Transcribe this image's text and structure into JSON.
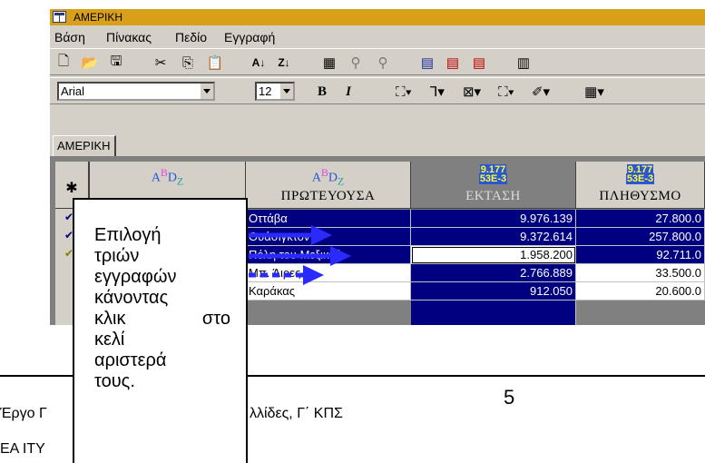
{
  "window": {
    "title": "ΑΜΕΡΙΚΗ"
  },
  "menu": {
    "items": [
      "Βάση",
      "Πίνακας",
      "Πεδίο",
      "Εγγραφή"
    ]
  },
  "toolbar1": {
    "icons": [
      "new-icon",
      "open-icon",
      "save-icon",
      "cut-icon",
      "copy-icon",
      "paste-icon",
      "sort-ascending-icon",
      "sort-descending-icon",
      "filter-icon",
      "find-icon",
      "find-next-icon",
      "add-record-icon",
      "delete-record-icon",
      "delete-icon",
      "table-view-icon"
    ]
  },
  "toolbar2": {
    "font_name": "Arial",
    "font_size": "12",
    "bold_label": "B",
    "italic_label": "I"
  },
  "tab": {
    "label": "ΑΜΕΡΙΚΗ"
  },
  "grid": {
    "corner_symbol": "✱",
    "headers": [
      {
        "type_glyph": "ABDZ",
        "label": ""
      },
      {
        "type_glyph": "ABDZ",
        "label": "ΠΡΩΤΕΥΟΥΣΑ"
      },
      {
        "type_glyph_top": "9.177",
        "type_glyph_bottom": "53E-3",
        "label": "ΕΚΤΑΣΗ"
      },
      {
        "type_glyph_top": "9.177",
        "type_glyph_bottom": "53E-3",
        "label": "ΠΛΗΘΥΣΜΟ"
      }
    ],
    "rows": [
      {
        "capital": "Οττάβα",
        "area": "9.976.139",
        "population": "27.800.0"
      },
      {
        "capital": "Ουάσιγκτον",
        "area": "9.372.614",
        "population": "257.800.0"
      },
      {
        "capital": "Πόλη του Μεξικού",
        "area": "1.958.200",
        "population": "92.711.0"
      },
      {
        "capital": "Μπ. Άιρες",
        "area": "2.766.889",
        "population": "33.500.0"
      },
      {
        "capital": "Καράκας",
        "area": "912.050",
        "population": "20.600.0"
      }
    ]
  },
  "callout": {
    "lines": [
      "Επιλογή",
      "τριών",
      "εγγραφών",
      "κάνοντας",
      "κλικ",
      "στο",
      "κελί",
      "αριστερά",
      "τους."
    ]
  },
  "footer": {
    "left_part1": "Έργο Γ",
    "left_part2": "λλίδες, Γ΄ ΚΠΣ",
    "page_number": "5",
    "bottom": "ΕΑ ΙΤΥ"
  },
  "colors": {
    "title_bar": "#d8a018",
    "selection": "#000080",
    "arrow": "#2a2aff"
  }
}
